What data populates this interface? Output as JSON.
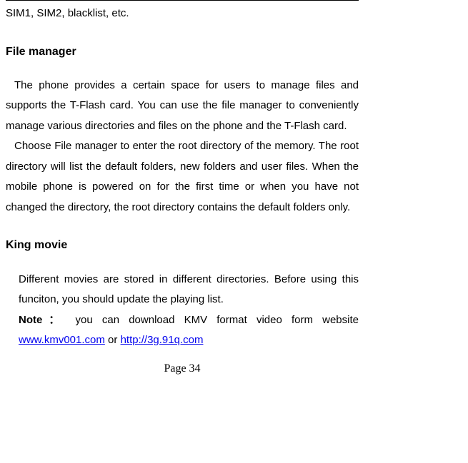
{
  "continued_line": "SIM1, SIM2, blacklist, etc.",
  "section1": {
    "heading": "File manager",
    "para1": "The phone provides a certain space for users to manage files and supports the T-Flash card. You can use the file manager to conveniently manage various directories and files on the phone and the T-Flash card.",
    "para2": "Choose File manager to enter the root directory of the memory. The root directory will list the default folders, new folders and user files. When the mobile phone is powered on for the first time or when you have not changed the directory, the root directory contains the default folders only."
  },
  "section2": {
    "heading": "King movie",
    "para1": "Different movies are stored in different directories. Before using this funciton, you should update the playing list.",
    "note_label": "Note：",
    "note_text": " you can download KMV format video form website ",
    "link1_text": "www.kmv001.com",
    "link1_href": "http://www.kmv001.com",
    "mid_text": " or ",
    "link2_text": "http://3g.91q.com",
    "link2_href": "http://3g.91q.com"
  },
  "page_number": "Page 34"
}
